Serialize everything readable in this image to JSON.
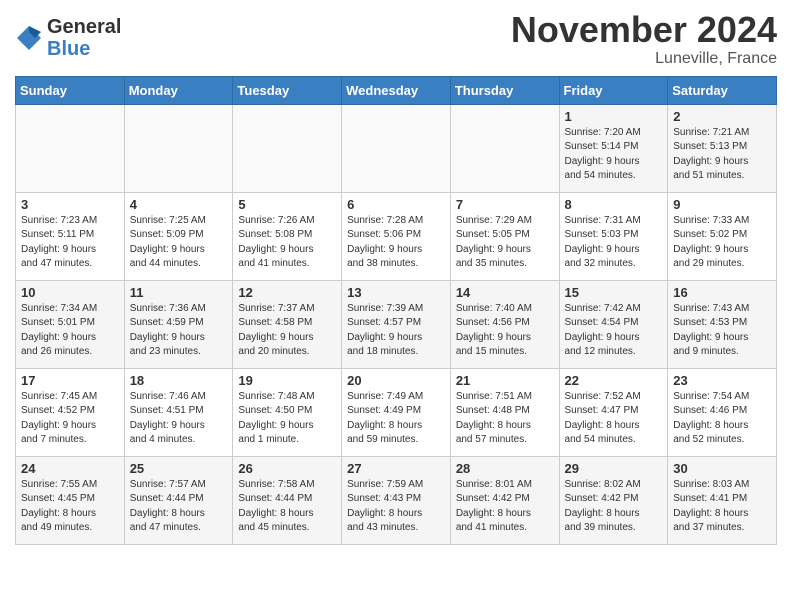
{
  "logo": {
    "general": "General",
    "blue": "Blue"
  },
  "title": "November 2024",
  "subtitle": "Luneville, France",
  "days_of_week": [
    "Sunday",
    "Monday",
    "Tuesday",
    "Wednesday",
    "Thursday",
    "Friday",
    "Saturday"
  ],
  "weeks": [
    [
      {
        "day": "",
        "info": ""
      },
      {
        "day": "",
        "info": ""
      },
      {
        "day": "",
        "info": ""
      },
      {
        "day": "",
        "info": ""
      },
      {
        "day": "",
        "info": ""
      },
      {
        "day": "1",
        "info": "Sunrise: 7:20 AM\nSunset: 5:14 PM\nDaylight: 9 hours\nand 54 minutes."
      },
      {
        "day": "2",
        "info": "Sunrise: 7:21 AM\nSunset: 5:13 PM\nDaylight: 9 hours\nand 51 minutes."
      }
    ],
    [
      {
        "day": "3",
        "info": "Sunrise: 7:23 AM\nSunset: 5:11 PM\nDaylight: 9 hours\nand 47 minutes."
      },
      {
        "day": "4",
        "info": "Sunrise: 7:25 AM\nSunset: 5:09 PM\nDaylight: 9 hours\nand 44 minutes."
      },
      {
        "day": "5",
        "info": "Sunrise: 7:26 AM\nSunset: 5:08 PM\nDaylight: 9 hours\nand 41 minutes."
      },
      {
        "day": "6",
        "info": "Sunrise: 7:28 AM\nSunset: 5:06 PM\nDaylight: 9 hours\nand 38 minutes."
      },
      {
        "day": "7",
        "info": "Sunrise: 7:29 AM\nSunset: 5:05 PM\nDaylight: 9 hours\nand 35 minutes."
      },
      {
        "day": "8",
        "info": "Sunrise: 7:31 AM\nSunset: 5:03 PM\nDaylight: 9 hours\nand 32 minutes."
      },
      {
        "day": "9",
        "info": "Sunrise: 7:33 AM\nSunset: 5:02 PM\nDaylight: 9 hours\nand 29 minutes."
      }
    ],
    [
      {
        "day": "10",
        "info": "Sunrise: 7:34 AM\nSunset: 5:01 PM\nDaylight: 9 hours\nand 26 minutes."
      },
      {
        "day": "11",
        "info": "Sunrise: 7:36 AM\nSunset: 4:59 PM\nDaylight: 9 hours\nand 23 minutes."
      },
      {
        "day": "12",
        "info": "Sunrise: 7:37 AM\nSunset: 4:58 PM\nDaylight: 9 hours\nand 20 minutes."
      },
      {
        "day": "13",
        "info": "Sunrise: 7:39 AM\nSunset: 4:57 PM\nDaylight: 9 hours\nand 18 minutes."
      },
      {
        "day": "14",
        "info": "Sunrise: 7:40 AM\nSunset: 4:56 PM\nDaylight: 9 hours\nand 15 minutes."
      },
      {
        "day": "15",
        "info": "Sunrise: 7:42 AM\nSunset: 4:54 PM\nDaylight: 9 hours\nand 12 minutes."
      },
      {
        "day": "16",
        "info": "Sunrise: 7:43 AM\nSunset: 4:53 PM\nDaylight: 9 hours\nand 9 minutes."
      }
    ],
    [
      {
        "day": "17",
        "info": "Sunrise: 7:45 AM\nSunset: 4:52 PM\nDaylight: 9 hours\nand 7 minutes."
      },
      {
        "day": "18",
        "info": "Sunrise: 7:46 AM\nSunset: 4:51 PM\nDaylight: 9 hours\nand 4 minutes."
      },
      {
        "day": "19",
        "info": "Sunrise: 7:48 AM\nSunset: 4:50 PM\nDaylight: 9 hours\nand 1 minute."
      },
      {
        "day": "20",
        "info": "Sunrise: 7:49 AM\nSunset: 4:49 PM\nDaylight: 8 hours\nand 59 minutes."
      },
      {
        "day": "21",
        "info": "Sunrise: 7:51 AM\nSunset: 4:48 PM\nDaylight: 8 hours\nand 57 minutes."
      },
      {
        "day": "22",
        "info": "Sunrise: 7:52 AM\nSunset: 4:47 PM\nDaylight: 8 hours\nand 54 minutes."
      },
      {
        "day": "23",
        "info": "Sunrise: 7:54 AM\nSunset: 4:46 PM\nDaylight: 8 hours\nand 52 minutes."
      }
    ],
    [
      {
        "day": "24",
        "info": "Sunrise: 7:55 AM\nSunset: 4:45 PM\nDaylight: 8 hours\nand 49 minutes."
      },
      {
        "day": "25",
        "info": "Sunrise: 7:57 AM\nSunset: 4:44 PM\nDaylight: 8 hours\nand 47 minutes."
      },
      {
        "day": "26",
        "info": "Sunrise: 7:58 AM\nSunset: 4:44 PM\nDaylight: 8 hours\nand 45 minutes."
      },
      {
        "day": "27",
        "info": "Sunrise: 7:59 AM\nSunset: 4:43 PM\nDaylight: 8 hours\nand 43 minutes."
      },
      {
        "day": "28",
        "info": "Sunrise: 8:01 AM\nSunset: 4:42 PM\nDaylight: 8 hours\nand 41 minutes."
      },
      {
        "day": "29",
        "info": "Sunrise: 8:02 AM\nSunset: 4:42 PM\nDaylight: 8 hours\nand 39 minutes."
      },
      {
        "day": "30",
        "info": "Sunrise: 8:03 AM\nSunset: 4:41 PM\nDaylight: 8 hours\nand 37 minutes."
      }
    ]
  ]
}
